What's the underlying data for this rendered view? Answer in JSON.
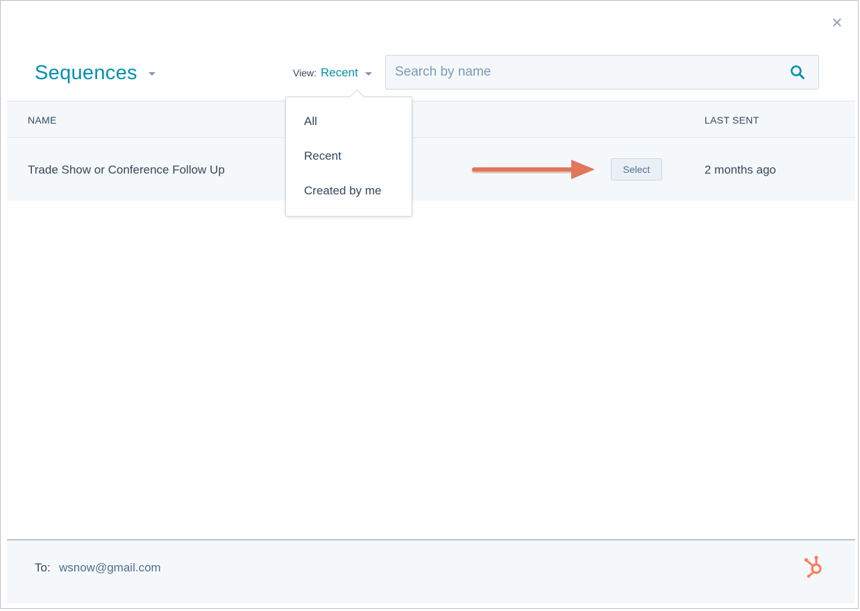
{
  "modal": {
    "close_icon": "close-icon",
    "title": "Sequences",
    "view": {
      "label": "View:",
      "value": "Recent"
    },
    "search": {
      "placeholder": "Search by name",
      "value": ""
    }
  },
  "dropdown": {
    "items": [
      "All",
      "Recent",
      "Created by me"
    ]
  },
  "table": {
    "columns": [
      "NAME",
      "LAST SENT"
    ],
    "rows": [
      {
        "name": "Trade Show or Conference Follow Up",
        "action": "Select",
        "last_sent": "2 months ago"
      }
    ]
  },
  "footer": {
    "to_label": "To:",
    "to_value": "wsnow@gmail.com",
    "logo_icon": "hubspot-logo-icon"
  },
  "colors": {
    "accent": "#0091ae",
    "text": "#33475b",
    "muted": "#7c98b6",
    "panel": "#f5f8fa",
    "arrow": "#e0775a",
    "brand": "#ff7a59"
  }
}
